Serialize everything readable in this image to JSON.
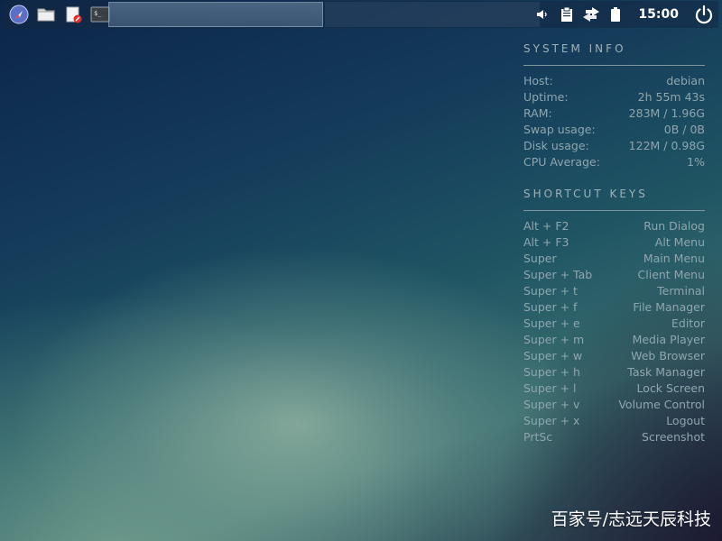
{
  "panel": {
    "launchers": [
      {
        "icon": "web-browser-icon"
      },
      {
        "icon": "file-manager-icon"
      },
      {
        "icon": "text-editor-icon"
      },
      {
        "icon": "terminal-icon"
      }
    ],
    "tray": {
      "icons": [
        "volume-icon",
        "clipboard-icon",
        "network-icon",
        "battery-icon",
        "power-icon"
      ]
    },
    "clock": "15:00"
  },
  "system_info": {
    "title": "SYSTEM INFO",
    "rows": [
      {
        "label": "Host:",
        "value": "debian"
      },
      {
        "label": "Uptime:",
        "value": "2h 55m 43s"
      },
      {
        "label": "RAM:",
        "value": "283M / 1.96G"
      },
      {
        "label": "Swap usage:",
        "value": "0B / 0B"
      },
      {
        "label": "Disk usage:",
        "value": "122M / 0.98G"
      },
      {
        "label": "CPU Average:",
        "value": "1%"
      }
    ]
  },
  "shortcut_keys": {
    "title": "SHORTCUT KEYS",
    "rows": [
      {
        "key": "Alt + F2",
        "action": "Run Dialog"
      },
      {
        "key": "Alt + F3",
        "action": "Alt Menu"
      },
      {
        "key": "Super",
        "action": "Main Menu"
      },
      {
        "key": "Super + Tab",
        "action": "Client Menu"
      },
      {
        "key": "Super + t",
        "action": "Terminal"
      },
      {
        "key": "Super + f",
        "action": "File Manager"
      },
      {
        "key": "Super + e",
        "action": "Editor"
      },
      {
        "key": "Super + m",
        "action": "Media Player"
      },
      {
        "key": "Super + w",
        "action": "Web Browser"
      },
      {
        "key": "Super + h",
        "action": "Task Manager"
      },
      {
        "key": "Super + l",
        "action": "Lock Screen"
      },
      {
        "key": "Super + v",
        "action": "Volume Control"
      },
      {
        "key": "Super + x",
        "action": "Logout"
      },
      {
        "key": "PrtSc",
        "action": "Screenshot"
      }
    ]
  },
  "watermark": "百家号/志远天辰科技"
}
